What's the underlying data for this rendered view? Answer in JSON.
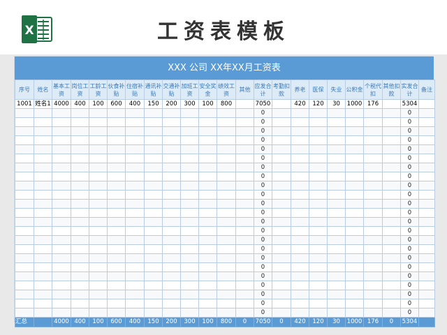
{
  "header": {
    "title": "工资表模板",
    "icon": "excel-icon"
  },
  "sheet": {
    "title": "XXX 公司 XX年XX月工资表",
    "columns": [
      "序号",
      "姓名",
      "基本工资",
      "岗位工资",
      "工龄工资",
      "伙食补贴",
      "住宿补贴",
      "通讯补贴",
      "交通补贴",
      "加班工资",
      "安全奖金",
      "绩效工资",
      "其他",
      "应发合计",
      "考勤扣款",
      "养老",
      "医保",
      "失业",
      "公积金",
      "个税代扣",
      "其他扣款",
      "实发合计",
      "备注"
    ],
    "rows": [
      [
        "1001",
        "姓名1",
        "4000",
        "400",
        "100",
        "600",
        "400",
        "150",
        "200",
        "300",
        "100",
        "800",
        "",
        "7050",
        "",
        "420",
        "120",
        "30",
        "1000",
        "176",
        "",
        "5304",
        ""
      ],
      [
        "",
        "",
        "",
        "",
        "",
        "",
        "",
        "",
        "",
        "",
        "",
        "",
        "",
        "0",
        "",
        "",
        "",
        "",
        "",
        "",
        "",
        "0",
        ""
      ],
      [
        "",
        "",
        "",
        "",
        "",
        "",
        "",
        "",
        "",
        "",
        "",
        "",
        "",
        "0",
        "",
        "",
        "",
        "",
        "",
        "",
        "",
        "0",
        ""
      ],
      [
        "",
        "",
        "",
        "",
        "",
        "",
        "",
        "",
        "",
        "",
        "",
        "",
        "",
        "0",
        "",
        "",
        "",
        "",
        "",
        "",
        "",
        "0",
        ""
      ],
      [
        "",
        "",
        "",
        "",
        "",
        "",
        "",
        "",
        "",
        "",
        "",
        "",
        "",
        "0",
        "",
        "",
        "",
        "",
        "",
        "",
        "",
        "0",
        ""
      ],
      [
        "",
        "",
        "",
        "",
        "",
        "",
        "",
        "",
        "",
        "",
        "",
        "",
        "",
        "0",
        "",
        "",
        "",
        "",
        "",
        "",
        "",
        "0",
        ""
      ],
      [
        "",
        "",
        "",
        "",
        "",
        "",
        "",
        "",
        "",
        "",
        "",
        "",
        "",
        "0",
        "",
        "",
        "",
        "",
        "",
        "",
        "",
        "0",
        ""
      ],
      [
        "",
        "",
        "",
        "",
        "",
        "",
        "",
        "",
        "",
        "",
        "",
        "",
        "",
        "0",
        "",
        "",
        "",
        "",
        "",
        "",
        "",
        "0",
        ""
      ],
      [
        "",
        "",
        "",
        "",
        "",
        "",
        "",
        "",
        "",
        "",
        "",
        "",
        "",
        "0",
        "",
        "",
        "",
        "",
        "",
        "",
        "",
        "0",
        ""
      ],
      [
        "",
        "",
        "",
        "",
        "",
        "",
        "",
        "",
        "",
        "",
        "",
        "",
        "",
        "0",
        "",
        "",
        "",
        "",
        "",
        "",
        "",
        "0",
        ""
      ],
      [
        "",
        "",
        "",
        "",
        "",
        "",
        "",
        "",
        "",
        "",
        "",
        "",
        "",
        "0",
        "",
        "",
        "",
        "",
        "",
        "",
        "",
        "0",
        ""
      ],
      [
        "",
        "",
        "",
        "",
        "",
        "",
        "",
        "",
        "",
        "",
        "",
        "",
        "",
        "0",
        "",
        "",
        "",
        "",
        "",
        "",
        "",
        "0",
        ""
      ],
      [
        "",
        "",
        "",
        "",
        "",
        "",
        "",
        "",
        "",
        "",
        "",
        "",
        "",
        "0",
        "",
        "",
        "",
        "",
        "",
        "",
        "",
        "0",
        ""
      ],
      [
        "",
        "",
        "",
        "",
        "",
        "",
        "",
        "",
        "",
        "",
        "",
        "",
        "",
        "0",
        "",
        "",
        "",
        "",
        "",
        "",
        "",
        "0",
        ""
      ],
      [
        "",
        "",
        "",
        "",
        "",
        "",
        "",
        "",
        "",
        "",
        "",
        "",
        "",
        "0",
        "",
        "",
        "",
        "",
        "",
        "",
        "",
        "0",
        ""
      ],
      [
        "",
        "",
        "",
        "",
        "",
        "",
        "",
        "",
        "",
        "",
        "",
        "",
        "",
        "0",
        "",
        "",
        "",
        "",
        "",
        "",
        "",
        "0",
        ""
      ],
      [
        "",
        "",
        "",
        "",
        "",
        "",
        "",
        "",
        "",
        "",
        "",
        "",
        "",
        "0",
        "",
        "",
        "",
        "",
        "",
        "",
        "",
        "0",
        ""
      ],
      [
        "",
        "",
        "",
        "",
        "",
        "",
        "",
        "",
        "",
        "",
        "",
        "",
        "",
        "0",
        "",
        "",
        "",
        "",
        "",
        "",
        "",
        "0",
        ""
      ],
      [
        "",
        "",
        "",
        "",
        "",
        "",
        "",
        "",
        "",
        "",
        "",
        "",
        "",
        "0",
        "",
        "",
        "",
        "",
        "",
        "",
        "",
        "0",
        ""
      ],
      [
        "",
        "",
        "",
        "",
        "",
        "",
        "",
        "",
        "",
        "",
        "",
        "",
        "",
        "0",
        "",
        "",
        "",
        "",
        "",
        "",
        "",
        "0",
        ""
      ],
      [
        "",
        "",
        "",
        "",
        "",
        "",
        "",
        "",
        "",
        "",
        "",
        "",
        "",
        "0",
        "",
        "",
        "",
        "",
        "",
        "",
        "",
        "0",
        ""
      ],
      [
        "",
        "",
        "",
        "",
        "",
        "",
        "",
        "",
        "",
        "",
        "",
        "",
        "",
        "0",
        "",
        "",
        "",
        "",
        "",
        "",
        "",
        "0",
        ""
      ],
      [
        "",
        "",
        "",
        "",
        "",
        "",
        "",
        "",
        "",
        "",
        "",
        "",
        "",
        "0",
        "",
        "",
        "",
        "",
        "",
        "",
        "",
        "0",
        ""
      ],
      [
        "",
        "",
        "",
        "",
        "",
        "",
        "",
        "",
        "",
        "",
        "",
        "",
        "",
        "0",
        "",
        "",
        "",
        "",
        "",
        "",
        "",
        "0",
        ""
      ]
    ],
    "total_row": [
      "汇总",
      "",
      "4000",
      "400",
      "100",
      "600",
      "400",
      "150",
      "200",
      "300",
      "100",
      "800",
      "0",
      "7050",
      "0",
      "420",
      "120",
      "30",
      "1000",
      "176",
      "0",
      "5304",
      ""
    ]
  },
  "colors": {
    "accent": "#5b9bd5",
    "header_fill": "#ddebf7",
    "header_text": "#3a78b8",
    "excel_green": "#1f7244"
  }
}
